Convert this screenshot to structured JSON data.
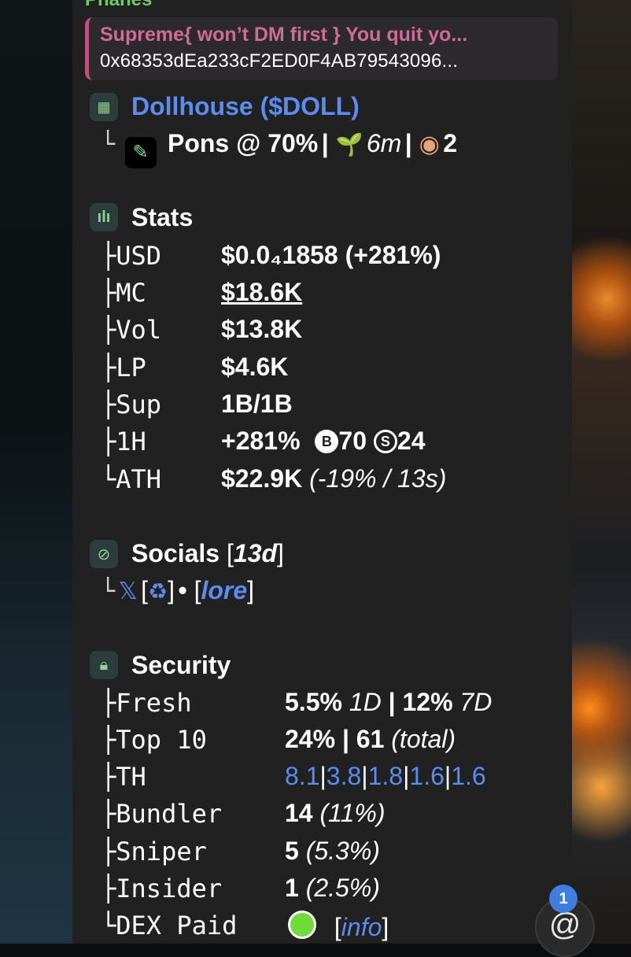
{
  "message": {
    "sender": "Phanes",
    "quote_line1": "Supreme{ won’t DM first } You quit yo...",
    "quote_line2": "0x68353dEa233cF2ED0F4AB79543096..."
  },
  "token": {
    "name": "Dollhouse",
    "ticker": "($DOLL)",
    "platform": "Pons @ 70%",
    "age": "6m",
    "watchers": "2"
  },
  "stats": {
    "title": "Stats",
    "rows": [
      {
        "label": "USD",
        "value": "$0.0₄1858 (+281%)"
      },
      {
        "label": "MC",
        "value": "$18.6K"
      },
      {
        "label": "Vol",
        "value": "$13.8K"
      },
      {
        "label": "LP",
        "value": "$4.6K"
      },
      {
        "label": "Sup",
        "value": "1B/1B"
      },
      {
        "label": "1H",
        "value": "+281%",
        "buys": "70",
        "sells": "24"
      },
      {
        "label": "ATH",
        "value": "$22.9K",
        "note": "(-19% / 13s)"
      }
    ]
  },
  "socials": {
    "title": "Socials",
    "age": "13d",
    "x_label": "𝕏",
    "recycle": "♻",
    "lore": "lore"
  },
  "security": {
    "title": "Security",
    "fresh": {
      "label": "Fresh",
      "v1": "5.5%",
      "p1": "1D",
      "v2": "12%",
      "p2": "7D"
    },
    "top10": {
      "label": "Top 10",
      "v1": "24%",
      "v2": "61",
      "note": "(total)"
    },
    "th": {
      "label": "TH",
      "values": [
        "8.1",
        "3.8",
        "1.8",
        "1.6",
        "1.6"
      ]
    },
    "bundler": {
      "label": "Bundler",
      "value": "14",
      "note": "(11%)"
    },
    "sniper": {
      "label": "Sniper",
      "value": "5",
      "note": "(5.3%)"
    },
    "insider": {
      "label": "Insider",
      "value": "1",
      "note": "(2.5%)"
    },
    "dex_paid": {
      "label": "DEX Paid",
      "info": "info"
    }
  },
  "fab": {
    "badge": "1",
    "symbol": "@"
  },
  "tree": {
    "branch": "├",
    "end": "└"
  },
  "colors": {
    "panel": "#212121",
    "link": "#5b8df0",
    "green": "#6fcb6a",
    "quote": "#d06b97"
  }
}
